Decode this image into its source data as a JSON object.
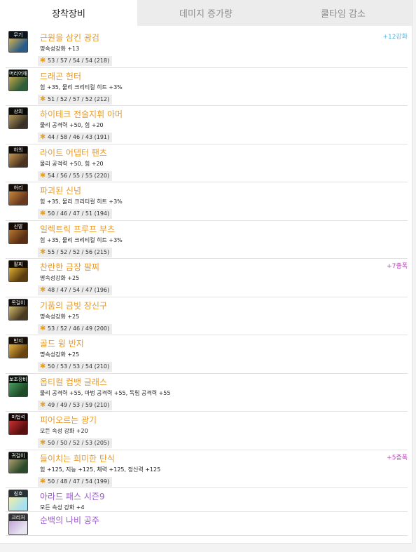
{
  "tabs": [
    {
      "label": "장착장비",
      "active": true
    },
    {
      "label": "데미지 증가량",
      "active": false
    },
    {
      "label": "쿨타임 감소",
      "active": false
    }
  ],
  "items": [
    {
      "tag": "무기",
      "name": "근원을 삼킨 광검",
      "option": "명속성강화 +13",
      "stats": "53 / 57 / 54 / 54 (218)",
      "badge": "+12강화",
      "badge_color": "#5bb5e0",
      "icon_colors": [
        "#2a5c8a",
        "#d9b34a"
      ]
    },
    {
      "tag": "머리어깨",
      "name": "드래곤 헌터",
      "option": "힘 +35, 물리 크리티컬 히트 +3%",
      "stats": "51 / 52 / 57 / 52 (212)",
      "badge": "",
      "badge_color": "",
      "icon_colors": [
        "#2f5e3a",
        "#c7a64a"
      ]
    },
    {
      "tag": "상의",
      "name": "하이테크 전술지휘 아머",
      "option": "물리 공격력 +50, 힘 +20",
      "stats": "44 / 58 / 46 / 43 (191)",
      "badge": "",
      "badge_color": "",
      "icon_colors": [
        "#3a3226",
        "#b89a5a"
      ]
    },
    {
      "tag": "하의",
      "name": "라이트 어댑터 팬츠",
      "option": "물리 공격력 +50, 힘 +20",
      "stats": "54 / 56 / 55 / 55 (220)",
      "badge": "",
      "badge_color": "",
      "icon_colors": [
        "#4a3320",
        "#c99a50"
      ]
    },
    {
      "tag": "허리",
      "name": "파괴된 신념",
      "option": "힘 +35, 물리 크리티컬 히트 +3%",
      "stats": "50 / 46 / 47 / 51 (194)",
      "badge": "",
      "badge_color": "",
      "icon_colors": [
        "#6a3a1e",
        "#c98a3a"
      ]
    },
    {
      "tag": "신발",
      "name": "일렉트릭 프루프 부츠",
      "option": "힘 +35, 물리 크리티컬 히트 +3%",
      "stats": "55 / 52 / 52 / 56 (215)",
      "badge": "",
      "badge_color": "",
      "icon_colors": [
        "#5a2e14",
        "#b8782e"
      ]
    },
    {
      "tag": "팔찌",
      "name": "찬란한 금장 팔찌",
      "option": "명속성강화 +25",
      "stats": "48 / 47 / 54 / 47 (196)",
      "badge": "+7증폭",
      "badge_color": "#c040c0",
      "icon_colors": [
        "#5a3c10",
        "#e0b030"
      ]
    },
    {
      "tag": "목걸이",
      "name": "기품의 금빛 장신구",
      "option": "명속성강화 +25",
      "stats": "53 / 52 / 46 / 49 (200)",
      "badge": "",
      "badge_color": "",
      "icon_colors": [
        "#4a3a20",
        "#d8c070"
      ]
    },
    {
      "tag": "반지",
      "name": "골드 윙 반지",
      "option": "명속성강화 +25",
      "stats": "50 / 53 / 53 / 54 (210)",
      "badge": "",
      "badge_color": "",
      "icon_colors": [
        "#6a4410",
        "#e8b840"
      ]
    },
    {
      "tag": "보조장비",
      "name": "옵티컬 컴뱃 글래스",
      "option": "물리 공격력 +55, 마법 공격력 +55, 독립 공격력 +55",
      "stats": "49 / 49 / 53 / 59 (210)",
      "badge": "",
      "badge_color": "",
      "icon_colors": [
        "#1e4a28",
        "#4aa060"
      ]
    },
    {
      "tag": "마법석",
      "name": "피어오르는 광기",
      "option": "모든 속성 강화 +20",
      "stats": "50 / 50 / 52 / 53 (205)",
      "badge": "",
      "badge_color": "",
      "icon_colors": [
        "#5a1010",
        "#d03030"
      ]
    },
    {
      "tag": "귀걸이",
      "name": "들이치는 희미한 탄식",
      "option": "힘 +125, 지능 +125, 체력 +125, 정신력 +125",
      "stats": "50 / 48 / 47 / 54 (199)",
      "badge": "+5증폭",
      "badge_color": "#c040c0",
      "icon_colors": [
        "#2a4a2a",
        "#b0a070"
      ]
    },
    {
      "tag": "칭호",
      "name": "아라드 패스 시즌9",
      "option": "모든 속성 강화 +4",
      "stats": "",
      "badge": "",
      "badge_color": "",
      "icon_colors": [
        "#a8e0f0",
        "#f4f0a0"
      ],
      "name_purple": true
    },
    {
      "tag": "크리처",
      "name": "순백의 나비 공주",
      "option": "",
      "stats": "",
      "badge": "",
      "badge_color": "",
      "icon_colors": [
        "#e8e4f0",
        "#c0a0d8"
      ],
      "name_purple": true
    }
  ]
}
